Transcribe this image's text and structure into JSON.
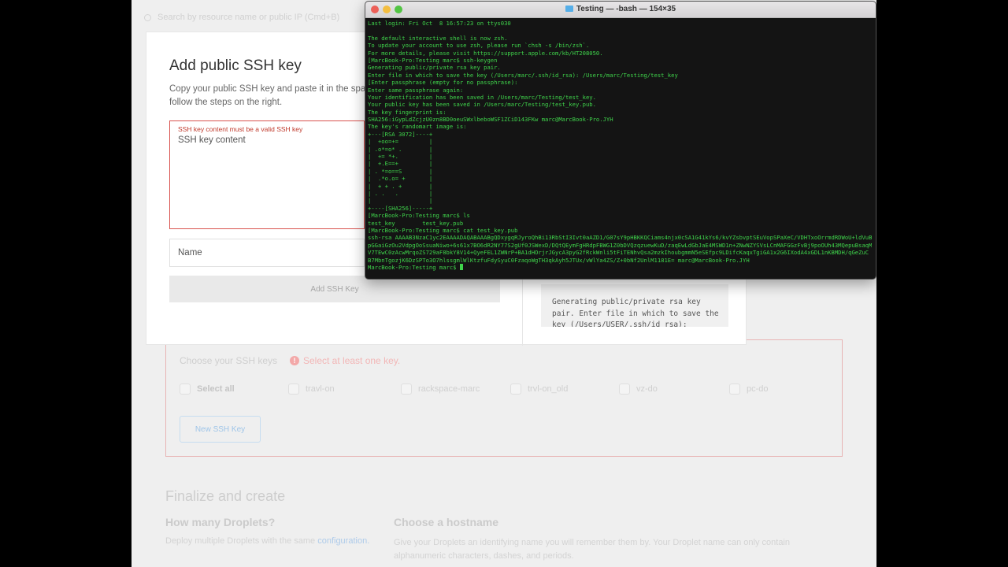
{
  "page": {
    "search_placeholder": "Search by resource name or public IP (Cmd+B)",
    "ssh_section": {
      "choose_label": "Choose your SSH keys",
      "warning": "Select at least one key.",
      "select_all": "Select all",
      "keys": [
        "travl-on",
        "rackspace-marc",
        "trvl-on_old",
        "vz-do",
        "pc-do"
      ],
      "new_ssh_button": "New SSH Key"
    },
    "finalize_title": "Finalize and create",
    "how_many_title": "How many Droplets?",
    "how_many_desc": "Deploy multiple Droplets with the same",
    "how_many_link": "configuration.",
    "choose_host_title": "Choose a hostname",
    "choose_host_desc": "Give your Droplets an identifying name you will remember them by. Your Droplet name can only contain alphanumeric characters, dashes, and periods."
  },
  "modal": {
    "title": "Add public SSH key",
    "desc_line1": "Copy your public SSH key and paste it in the spa",
    "desc_line2": "follow the steps on the right.",
    "key_error": "SSH key content must be a valid SSH key",
    "key_placeholder": "SSH key content",
    "name_placeholder": "Name",
    "add_button": "Add SSH Key",
    "code_text": "Generating public/private rsa key pair. Enter file in which to save the key (/Users/USER/.ssh/id_rsa):"
  },
  "terminal": {
    "title": "Testing — -bash — 154×35",
    "lines": [
      "Last login: Fri Oct  8 16:57:23 on ttys030",
      "",
      "The default interactive shell is now zsh.",
      "To update your account to use zsh, please run `chsh -s /bin/zsh`.",
      "For more details, please visit https://support.apple.com/kb/HT208050.",
      "[MarcBook-Pro:Testing marc$ ssh-keygen",
      "Generating public/private rsa key pair.",
      "Enter file in which to save the key (/Users/marc/.ssh/id_rsa): /Users/marc/Testing/test_key",
      "[Enter passphrase (empty for no passphrase):",
      "Enter same passphrase again:",
      "Your identification has been saved in /Users/marc/Testing/test_key.",
      "Your public key has been saved in /Users/marc/Testing/test_key.pub.",
      "The key fingerprint is:",
      "SHA256:iGypLdZcjzU0zn8BD0oeuSWxlbeboWSF1ZCiD143FKw marc@MarcBook-Pro.JYH",
      "The key's randomart image is:",
      "+---[RSA 3072]----+",
      "|  +oo=+=         |",
      "| .o*=o* .        |",
      "|  += *+.         |",
      "|  +.E==+         |",
      "| . *=o==S        |",
      "|  .*o.o= +       |",
      "|  + + . +        |",
      "| . .   .         |",
      "|                 |",
      "+----[SHA256]-----+",
      "[MarcBook-Pro:Testing marc$ ls",
      "test_key        test_key.pub",
      "[MarcBook-Pro:Testing marc$ cat test_key.pub",
      "ssh-rsa AAAAB3NzaC1yc2EAAAADAQABAAABgQDxygqRJyroQhBi13RbStI3Ivt0aAZD1/G07sY9pHBKKQCiams4njx0cSA1G41kYs6/kvYZsbvptSEuVopSPaXeC/VDHTxoOrrmdRDWoU+ldVuBH",
      "pGGaiGzOu2VdpgOoSsuaNiwo+6s61x7BO6dR2NY77S2gUf0JSWexD/DQtQEymFgHRdpFBWG1Z0bDVQzqzuewKuD/zaqEwLdGbJaE4MSWD1n+ZNwNZYSVsLCnMAFGGzFvBj9poOUh43MQepuBsaqMH",
      "V7TEwC0zAcwMrqoZS729aF8bkY8V14+QyeFEL1ZWNrP+BA1dHOrjrJGycA3pyG2fRckWnli5tFiTENhvQsa2mzkIhoubgmmN5eSEfpc9LDifcKaqxTgiGA1x2G6IXodA4xGDL1nKBMDH/qGeZuC",
      "B7MbnTgozjK6DzSPTo3O7hlssgmlWlKtzfuFdySyuC0FzaqoWgTH3qkAyh5JTUx/vWlYa4ZS/Z+0bNf2UnlM1181E= marc@MarcBook-Pro.JYH",
      "MarcBook-Pro:Testing marc$ "
    ]
  },
  "colors": {
    "terminal_text": "#3fd44b",
    "terminal_bg": "#141414",
    "error": "#d9534f"
  }
}
